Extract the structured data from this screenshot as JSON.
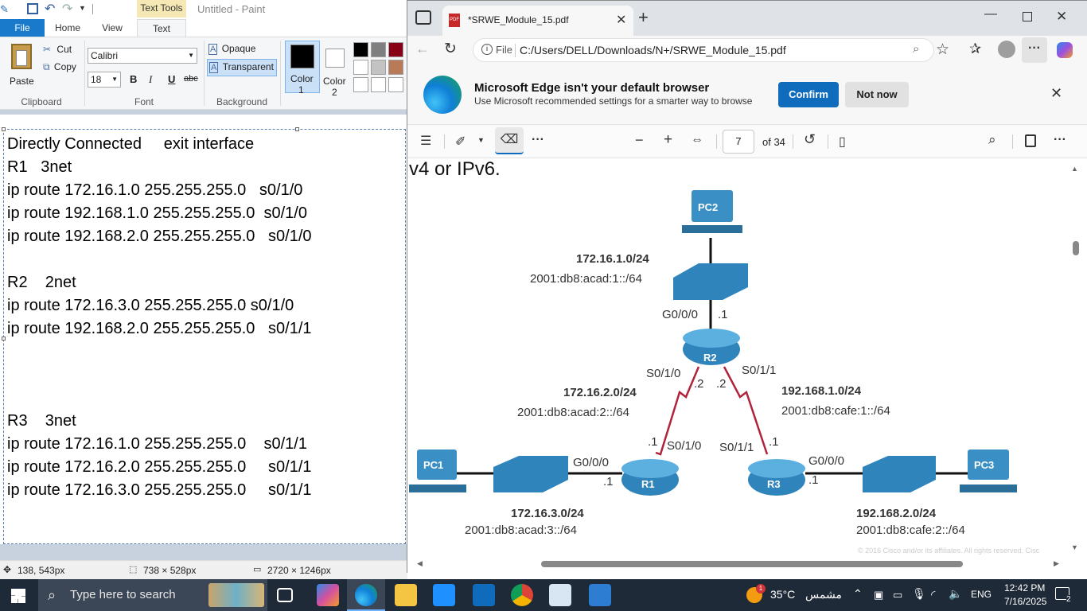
{
  "paint": {
    "context_tab": "Text Tools",
    "window_title": "Untitled - Paint",
    "tabs": [
      "File",
      "Home",
      "View",
      "Text"
    ],
    "clipboard": {
      "paste": "Paste",
      "cut": "Cut",
      "copy": "Copy",
      "group": "Clipboard"
    },
    "font": {
      "family": "Calibri",
      "size": "18",
      "group": "Font",
      "bold": "B",
      "italic": "I",
      "underline": "U",
      "strike": "abc"
    },
    "background": {
      "opaque": "Opaque",
      "transparent": "Transparent",
      "group": "Background"
    },
    "color1": {
      "label_a": "Color",
      "label_b": "1"
    },
    "color2": {
      "label_a": "Color",
      "label_b": "2"
    },
    "palette": [
      "#000000",
      "#7f7f7f",
      "#880015",
      "#ffffff",
      "#c3c3c3",
      "#b97a57",
      "#ffffff",
      "#ffffff",
      "#ffffff"
    ],
    "text_lines": [
      "Directly Connected     exit interface",
      "R1   3net",
      "ip route 172.16.1.0 255.255.255.0   s0/1/0",
      "ip route 192.168.1.0 255.255.255.0  s0/1/0",
      "ip route 192.168.2.0 255.255.255.0   s0/1/0",
      "",
      "R2    2net",
      "ip route 172.16.3.0 255.255.255.0 s0/1/0",
      "ip route 192.168.2.0 255.255.255.0   s0/1/1",
      "",
      "",
      "",
      "R3    3net",
      "ip route 172.16.1.0 255.255.255.0    s0/1/1",
      "ip route 172.16.2.0 255.255.255.0     s0/1/1",
      "ip route 172.16.3.0 255.255.255.0     s0/1/1"
    ],
    "status": {
      "cursor": "138, 543px",
      "selection": "738 × 528px",
      "size": "2720 × 1246px"
    }
  },
  "edge": {
    "tab_title": "*SRWE_Module_15.pdf",
    "url_prefix": "File",
    "url": "C:/Users/DELL/Downloads/N+/SRWE_Module_15.pdf",
    "banner": {
      "title": "Microsoft Edge isn't your default browser",
      "subtitle": "Use Microsoft recommended settings for a smarter way to browse",
      "confirm": "Confirm",
      "not_now": "Not now"
    },
    "pdf": {
      "page": "7",
      "of": "of 34",
      "heading": "v4 or IPv6.",
      "footer": "© 2016  Cisco and/or its affiliates. All rights reserved.  Cisc"
    }
  },
  "diagram": {
    "devices": [
      "PC2",
      "R2",
      "R1",
      "R3",
      "PC1",
      "PC3"
    ],
    "labels": {
      "net1": "172.16.1.0/24",
      "net1v6": "2001:db8:acad:1::/64",
      "r2_g": "G0/0/0",
      "r2_g_ip": ".1",
      "r2_s0": "S0/1/0",
      "r2_s1": "S0/1/1",
      "r2_s0_ip": ".2",
      "r2_s1_ip": ".2",
      "net2": "172.16.2.0/24",
      "net2v6": "2001:db8:acad:2::/64",
      "net4": "192.168.1.0/24",
      "net4v6": "2001:db8:cafe:1::/64",
      "r1_s_ip": ".1",
      "r1_s": "S0/1/0",
      "r3_s": "S0/1/1",
      "r3_s_ip": ".1",
      "r1_g": "G0/0/0",
      "r1_g_ip": ".1",
      "r3_g": "G0/0/0",
      "r3_g_ip": ".1",
      "net3": "172.16.3.0/24",
      "net3v6": "2001:db8:acad:3::/64",
      "net5": "192.168.2.0/24",
      "net5v6": "2001:db8:cafe:2::/64"
    }
  },
  "taskbar": {
    "search_placeholder": "Type here to search",
    "weather": "35°C",
    "weather_text": "مشمس",
    "weather_badge": "1",
    "lang": "ENG",
    "time": "12:42 PM",
    "date": "7/16/2025",
    "notif": "2"
  }
}
